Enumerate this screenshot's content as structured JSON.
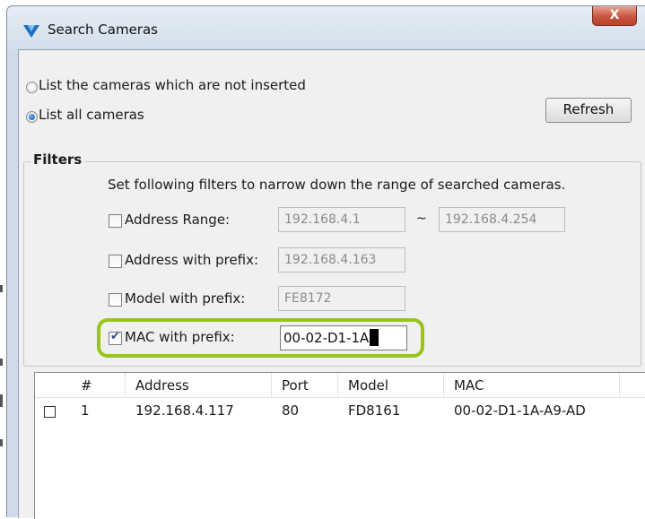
{
  "window": {
    "title": "Search Cameras",
    "close_label": "X"
  },
  "options": {
    "not_inserted_label": "List the cameras which are not inserted",
    "all_cameras_label": "List all cameras",
    "selected": "all_cameras",
    "refresh_label": "Refresh"
  },
  "filters": {
    "title": "Filters",
    "description": "Set following filters to narrow down the range of searched cameras.",
    "address_range": {
      "label": "Address Range:",
      "checked": false,
      "from": "192.168.4.1",
      "separator": "~",
      "to": "192.168.4.254"
    },
    "address_prefix": {
      "label": "Address with prefix:",
      "checked": false,
      "value": "192.168.4.163"
    },
    "model_prefix": {
      "label": "Model with prefix:",
      "checked": false,
      "value": "FE8172"
    },
    "mac_prefix": {
      "label": "MAC with prefix:",
      "checked": true,
      "value": "00-02-D1-1A"
    },
    "highlight_color": "#9ac31c"
  },
  "list": {
    "columns": [
      "#",
      "Address",
      "Port",
      "Model",
      "MAC"
    ],
    "rows": [
      {
        "checked": false,
        "index": "1",
        "address": "192.168.4.117",
        "port": "80",
        "model": "FD8161",
        "mac": "00-02-D1-1A-A9-AD"
      }
    ]
  }
}
